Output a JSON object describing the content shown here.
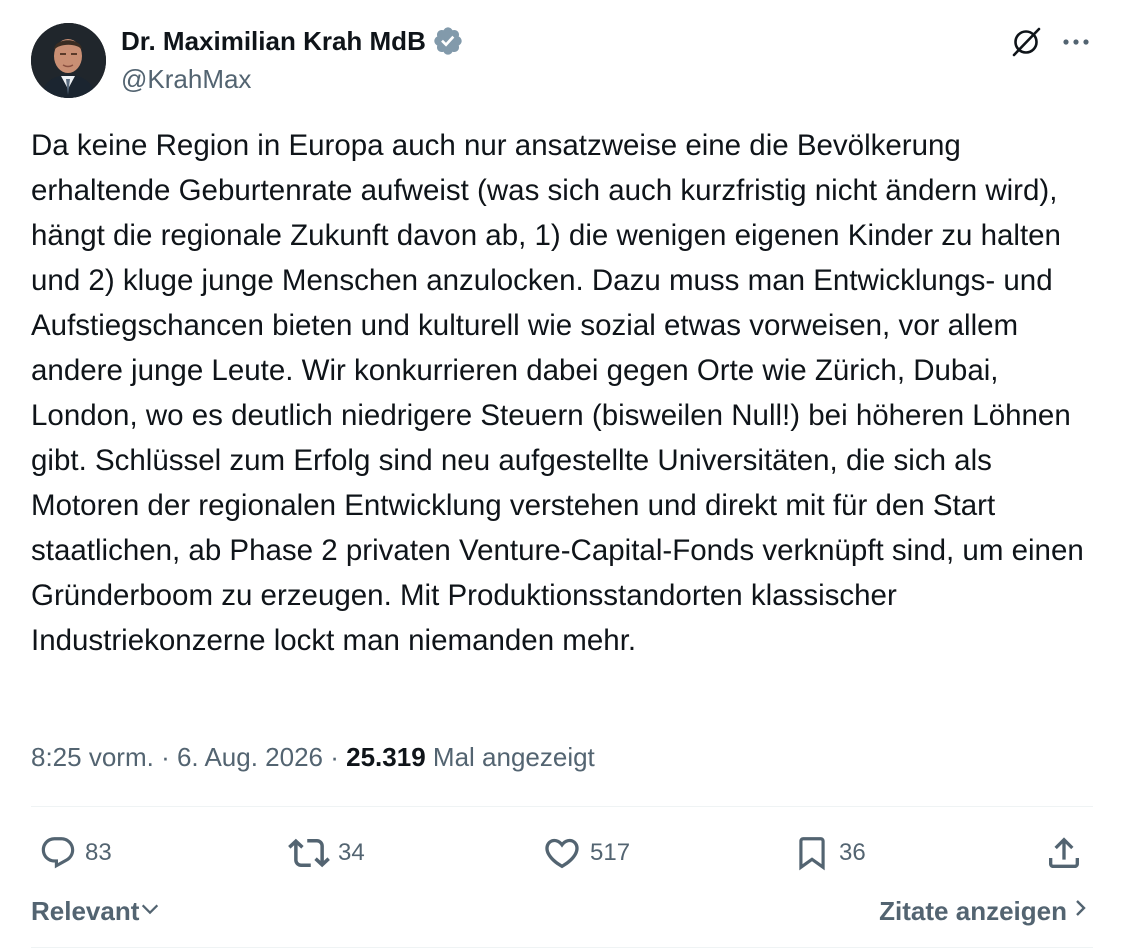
{
  "author": {
    "display_name": "Dr. Maximilian Krah MdB",
    "handle": "@KrahMax",
    "verified": true
  },
  "tweet": {
    "text": "Da keine Region in Europa auch nur ansatzweise eine die Bevölkerung erhaltende Geburtenrate aufweist (was sich auch kurzfristig nicht ändern wird), hängt die regionale Zukunft davon ab, 1) die wenigen eigenen Kinder zu halten und 2) kluge junge Menschen anzulocken. Dazu muss man Entwicklungs- und Aufstiegschancen bieten und kulturell wie sozial etwas vorweisen, vor allem andere junge Leute. Wir konkurrieren dabei gegen Orte wie Zürich, Dubai, London, wo es deutlich niedrigere Steuern (bisweilen Null!) bei höheren Löhnen gibt. Schlüssel zum Erfolg sind neu aufgestellte Universitäten, die sich als Motoren der regionalen Entwicklung verstehen und direkt mit für den Start staatlichen, ab Phase 2 privaten Venture-Capital-Fonds verknüpft sind, um einen Gründerboom zu erzeugen. Mit Produktionsstandorten klassischer Industriekonzerne lockt man niemanden mehr."
  },
  "meta": {
    "time": "8:25 vorm.",
    "separator": "·",
    "date": "6. Aug. 2026",
    "views_count": "25.319",
    "views_label": "Mal angezeigt"
  },
  "actions": {
    "replies": "83",
    "reposts": "34",
    "likes": "517",
    "bookmarks": "36"
  },
  "footer": {
    "sort_label": "Relevant",
    "quotes_label": "Zitate anzeigen"
  },
  "colors": {
    "text_primary": "#0f1419",
    "text_secondary": "#536471",
    "verified_badge": "#829aab",
    "divider": "#eff3f4"
  },
  "icons": {
    "verified": "verified-badge-icon",
    "grok": "grok-icon",
    "more": "more-options-icon",
    "reply": "reply-icon",
    "repost": "repost-icon",
    "like": "heart-icon",
    "bookmark": "bookmark-icon",
    "share": "share-icon",
    "sort": "chevron-down-icon",
    "quotes": "chevron-right-icon"
  }
}
